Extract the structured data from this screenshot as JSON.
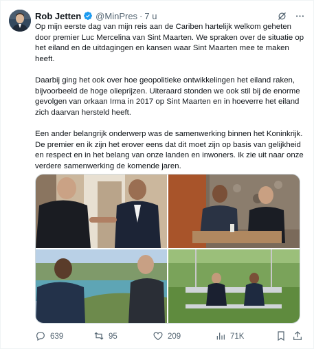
{
  "author": {
    "name": "Rob Jetten",
    "handle": "@MinPres",
    "separator": "·",
    "time": "7 u"
  },
  "tweet": {
    "paragraphs": [
      "Op mijn eerste dag van mijn reis aan de Cariben hartelijk welkom geheten door premier Luc Mercelina van Sint Maarten. We spraken over de situatie op het eiland en de uitdagingen en kansen waar Sint Maarten mee te maken heeft.",
      "Daarbij ging het ook over hoe geopolitieke ontwikkelingen het eiland raken, bijvoorbeeld de hoge olieprijzen. Uiteraard stonden we ook stil bij de enorme gevolgen van orkaan Irma in 2017 op Sint Maarten en in hoeverre het eiland zich daarvan hersteld heeft.",
      "Een ander belangrijk onderwerp was de samenwerking binnen het Koninkrijk. De premier en ik zijn het erover eens dat dit moet zijn op basis van gelijkheid en respect en in het belang van onze landen en inwoners. Ik zie uit naar onze verdere samenwerking de komende jaren."
    ]
  },
  "metrics": {
    "replies": "639",
    "reposts": "95",
    "likes": "209",
    "views": "71K"
  },
  "icons": {
    "header": [
      "verified-badge-icon",
      "grok-icon",
      "more-icon"
    ],
    "actions": [
      "reply-icon",
      "repost-icon",
      "like-icon",
      "views-icon",
      "bookmark-icon",
      "share-icon"
    ]
  },
  "colors": {
    "verified": "#1d9bf0",
    "secondary_text": "#536471",
    "text": "#0f1419"
  }
}
